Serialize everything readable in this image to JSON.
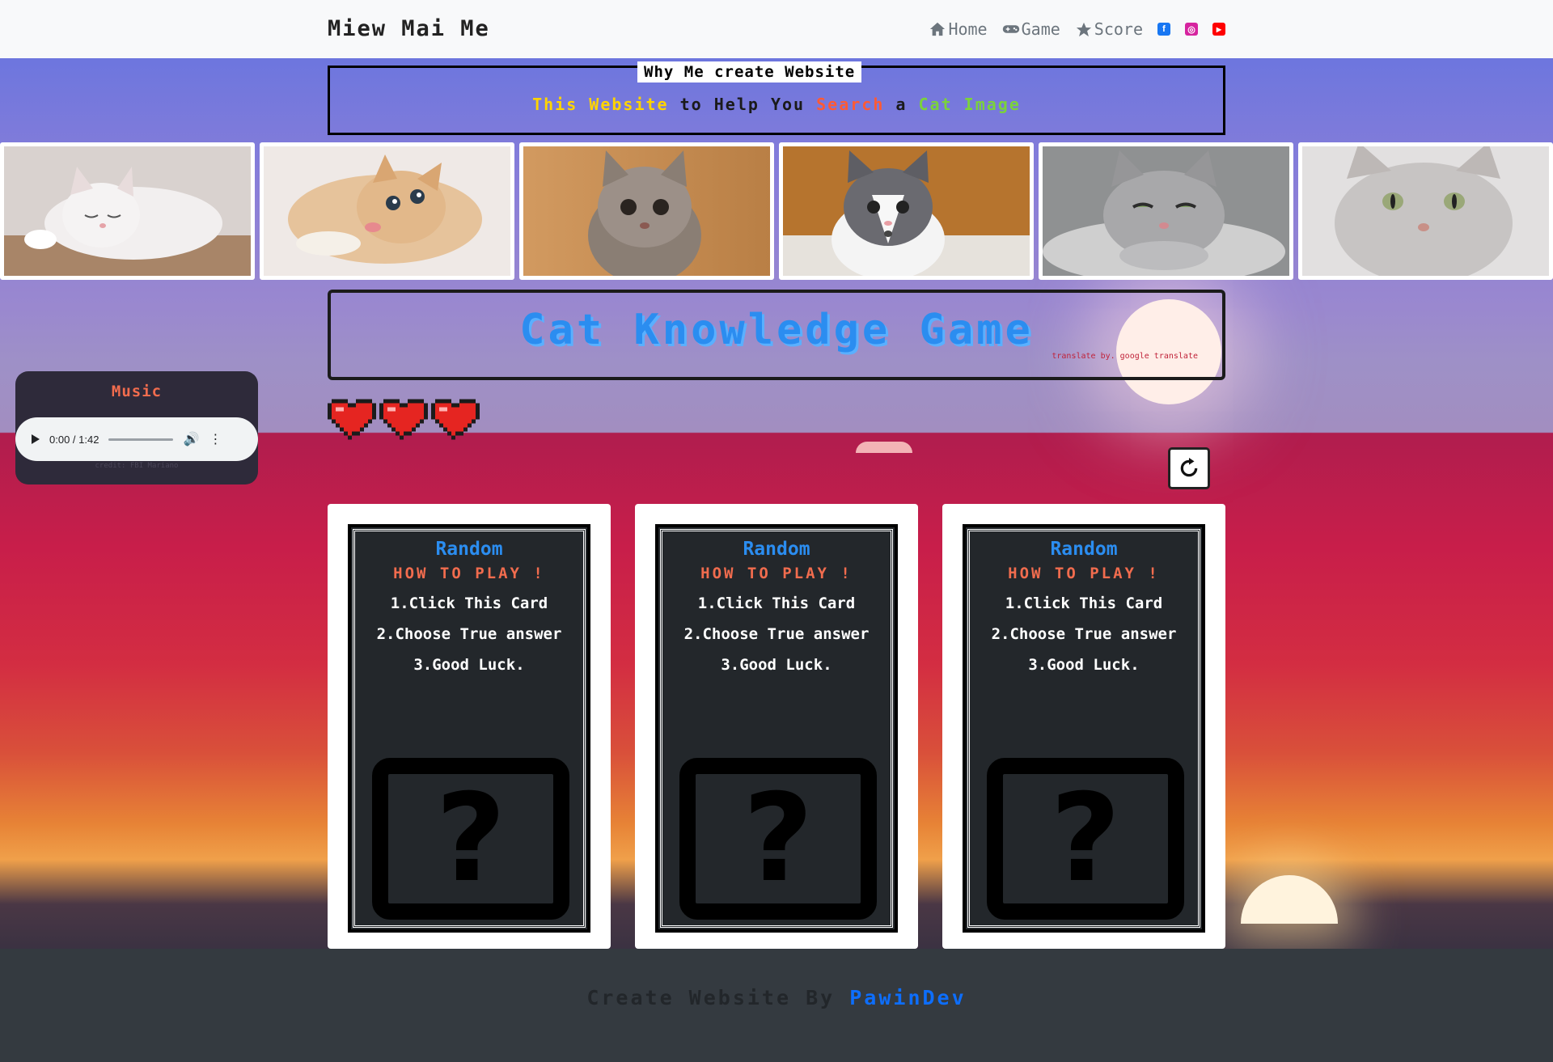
{
  "navbar": {
    "brand": "Miew Mai Me",
    "links": [
      {
        "label": "Home",
        "icon": "home-icon"
      },
      {
        "label": "Game",
        "icon": "gamepad-icon"
      },
      {
        "label": "Score",
        "icon": "star-icon"
      }
    ],
    "social": [
      {
        "name": "facebook-icon",
        "color": "#1877f2",
        "glyph": "f"
      },
      {
        "name": "instagram-icon",
        "color": "#d6249f",
        "glyph": "◎"
      },
      {
        "name": "youtube-icon",
        "color": "#ff0000",
        "glyph": "▶"
      }
    ]
  },
  "why": {
    "title": "Why Me create Website",
    "parts": [
      {
        "text": "This Website",
        "color": "#ffd400"
      },
      {
        "text": " to Help You ",
        "color": "#1a1a1a"
      },
      {
        "text": "Search",
        "color": "#ff5a36"
      },
      {
        "text": " a ",
        "color": "#1a1a1a"
      },
      {
        "text": "Cat Image",
        "color": "#7bd23c"
      }
    ]
  },
  "game": {
    "title": "Cat Knowledge Game",
    "translate_note": "translate by. google translate",
    "lives": 3
  },
  "music": {
    "title": "Music",
    "time": "0:00 / 1:42",
    "progress": 0,
    "credit": "credit: FBI Mariano"
  },
  "cards": [
    {
      "title": "Random",
      "howto": "HOW TO PLAY !",
      "steps": [
        "1.Click This Card",
        "2.Choose True answer",
        "3.Good Luck."
      ],
      "mystery": "?"
    },
    {
      "title": "Random",
      "howto": "HOW TO PLAY !",
      "steps": [
        "1.Click This Card",
        "2.Choose True answer",
        "3.Good Luck."
      ],
      "mystery": "?"
    },
    {
      "title": "Random",
      "howto": "HOW TO PLAY !",
      "steps": [
        "1.Click This Card",
        "2.Choose True answer",
        "3.Good Luck."
      ],
      "mystery": "?"
    }
  ],
  "footer": {
    "prefix": "Create Website By ",
    "author": "PawinDev"
  },
  "colors": {
    "accent_blue": "#2b8df0",
    "accent_orange": "#f16c4e",
    "footer_bg": "#343a40"
  }
}
